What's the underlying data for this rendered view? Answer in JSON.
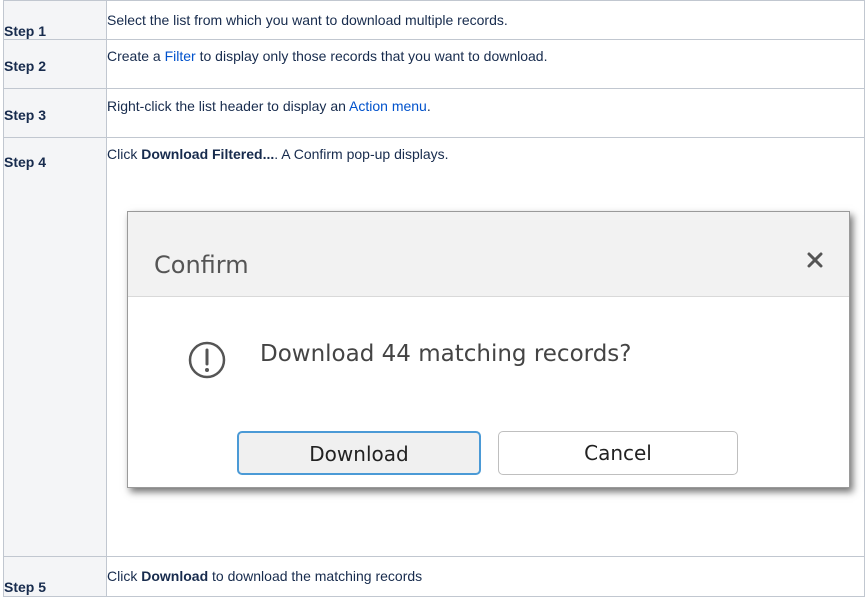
{
  "steps": [
    {
      "label": "Step 1",
      "parts": {
        "a": "Select the list from which you want to download multiple records."
      }
    },
    {
      "label": "Step 2",
      "parts": {
        "a": "Create a ",
        "link": "Filter",
        "b": " to display only those records that you want to download."
      }
    },
    {
      "label": "Step 3",
      "parts": {
        "a": "Right-click the list header to display an ",
        "link": "Action menu",
        "b": "."
      }
    },
    {
      "label": "Step 4",
      "parts": {
        "a": "Click ",
        "bold": "Download Filtered...",
        "b": ". A Confirm pop-up displays."
      }
    },
    {
      "label": "Step 5",
      "parts": {
        "a": "Click ",
        "bold": "Download",
        "b": " to download the matching records"
      }
    }
  ],
  "dialog": {
    "title": "Confirm",
    "message": "Download 44 matching records?",
    "download_label": "Download",
    "cancel_label": "Cancel",
    "icons": {
      "close": "close-icon",
      "alert": "exclamation-circle-icon"
    }
  },
  "colors": {
    "link": "#0052cc",
    "focus_border": "#4b9ad6",
    "header_bg": "#f4f5f7"
  }
}
